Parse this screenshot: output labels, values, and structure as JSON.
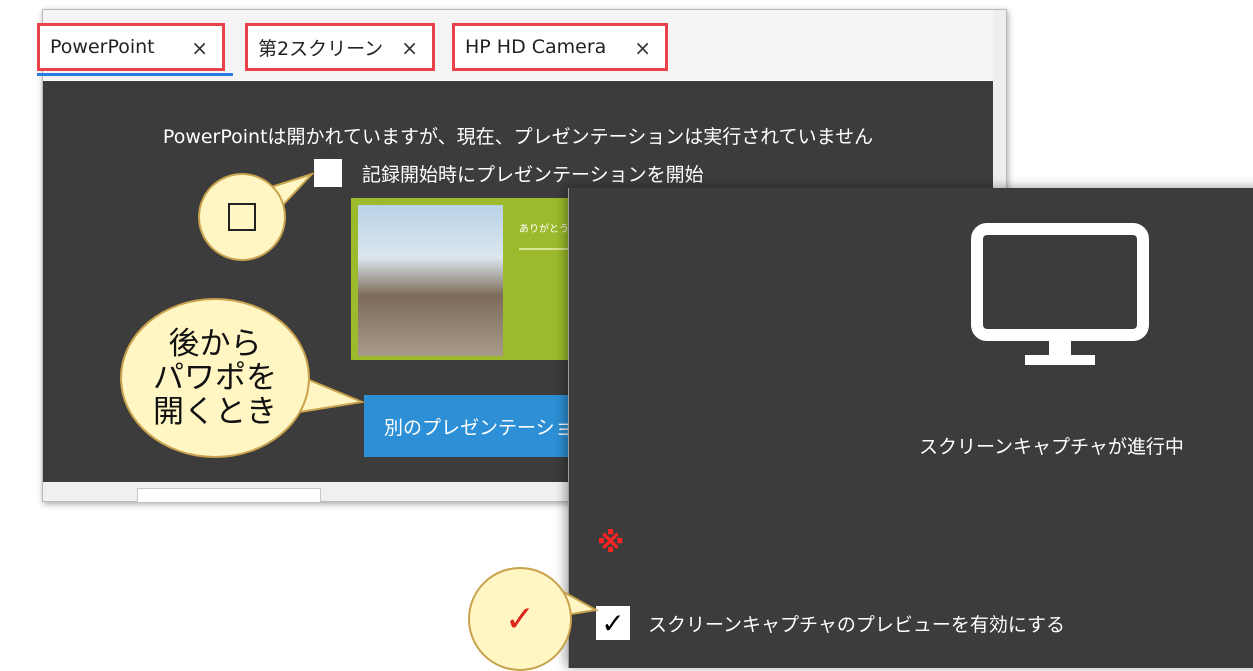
{
  "tabs": [
    {
      "label": "PowerPoint",
      "close": "×"
    },
    {
      "label": "第2スクリーン",
      "close": "×"
    },
    {
      "label": "HP HD Camera",
      "close": "×"
    }
  ],
  "main": {
    "message": "PowerPointは開かれていますが、現在、プレゼンテーションは実行されていません",
    "start_on_record_label": "記録開始時にプレゼンテーションを開始",
    "slide_thumbnail_text": "ありがとう",
    "open_other_button": "別のプレゼンテーション"
  },
  "capture_window": {
    "status_text": "スクリーンキャプチャが進行中",
    "note_mark": "※",
    "preview_checkbox_checked": true,
    "preview_checkbox_glyph": "✓",
    "preview_label": "スクリーンキャプチャのプレビューを有効にする",
    "icon": "monitor-icon"
  },
  "callouts": {
    "checkbox_symbol": "□",
    "later_open": [
      "後から",
      "パワポを",
      "開くとき"
    ],
    "check_symbol": "✓"
  },
  "colors": {
    "highlight_red": "#e8434a",
    "dark_panel": "#3c3c3c",
    "button_blue": "#2d8fd5",
    "callout_fill": "#fff6c4",
    "slide_green": "#9bbb2c"
  }
}
